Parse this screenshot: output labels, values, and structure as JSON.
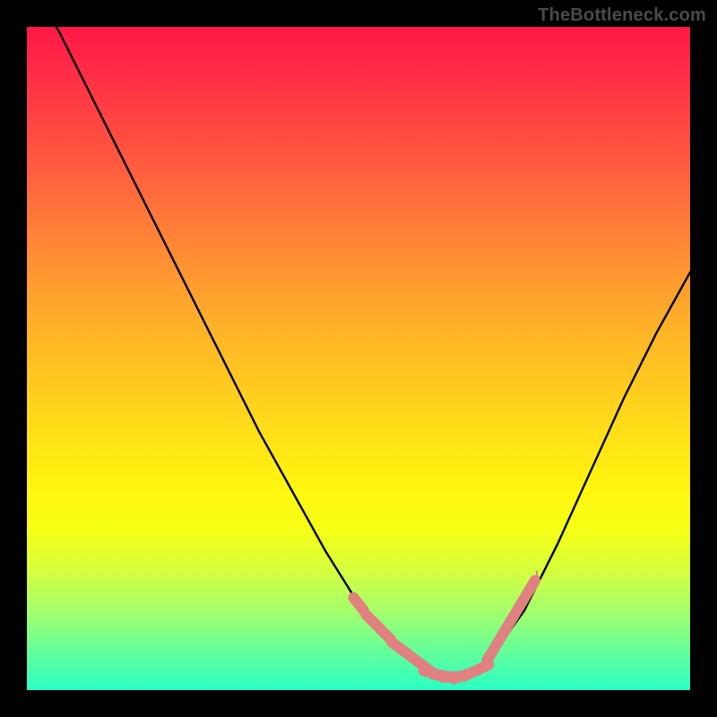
{
  "watermark": "TheBottleneck.com",
  "chart_data": {
    "type": "line",
    "title": "",
    "xlabel": "",
    "ylabel": "",
    "xlim": [
      0,
      100
    ],
    "ylim": [
      0,
      100
    ],
    "series": [
      {
        "name": "main-curve",
        "color": "#000000",
        "x": [
          0,
          5,
          10,
          15,
          20,
          25,
          30,
          35,
          40,
          45,
          50,
          55,
          60,
          62,
          64,
          66,
          68,
          70,
          75,
          80,
          85,
          90,
          95,
          100
        ],
        "y": [
          108,
          99,
          89,
          79,
          69,
          59,
          49,
          39,
          30,
          21,
          13,
          7,
          3,
          2,
          1.8,
          2,
          3,
          5,
          12,
          22,
          33,
          44,
          54,
          63
        ]
      },
      {
        "name": "marker-cluster-left",
        "color": "#e08080",
        "x": [
          50,
          52,
          54,
          56,
          58,
          60
        ],
        "y": [
          13,
          10.5,
          8.5,
          6.5,
          5,
          3.5
        ]
      },
      {
        "name": "marker-cluster-bottom",
        "color": "#e08080",
        "x": [
          61,
          62.5,
          64,
          65.5,
          67,
          68.5
        ],
        "y": [
          2.6,
          2.2,
          2.0,
          2.1,
          2.6,
          3.3
        ]
      },
      {
        "name": "marker-cluster-right",
        "color": "#e08080",
        "x": [
          70,
          71.5,
          73,
          74.5,
          76
        ],
        "y": [
          5.5,
          8,
          10.5,
          13,
          15.5
        ]
      }
    ],
    "annotations": []
  }
}
